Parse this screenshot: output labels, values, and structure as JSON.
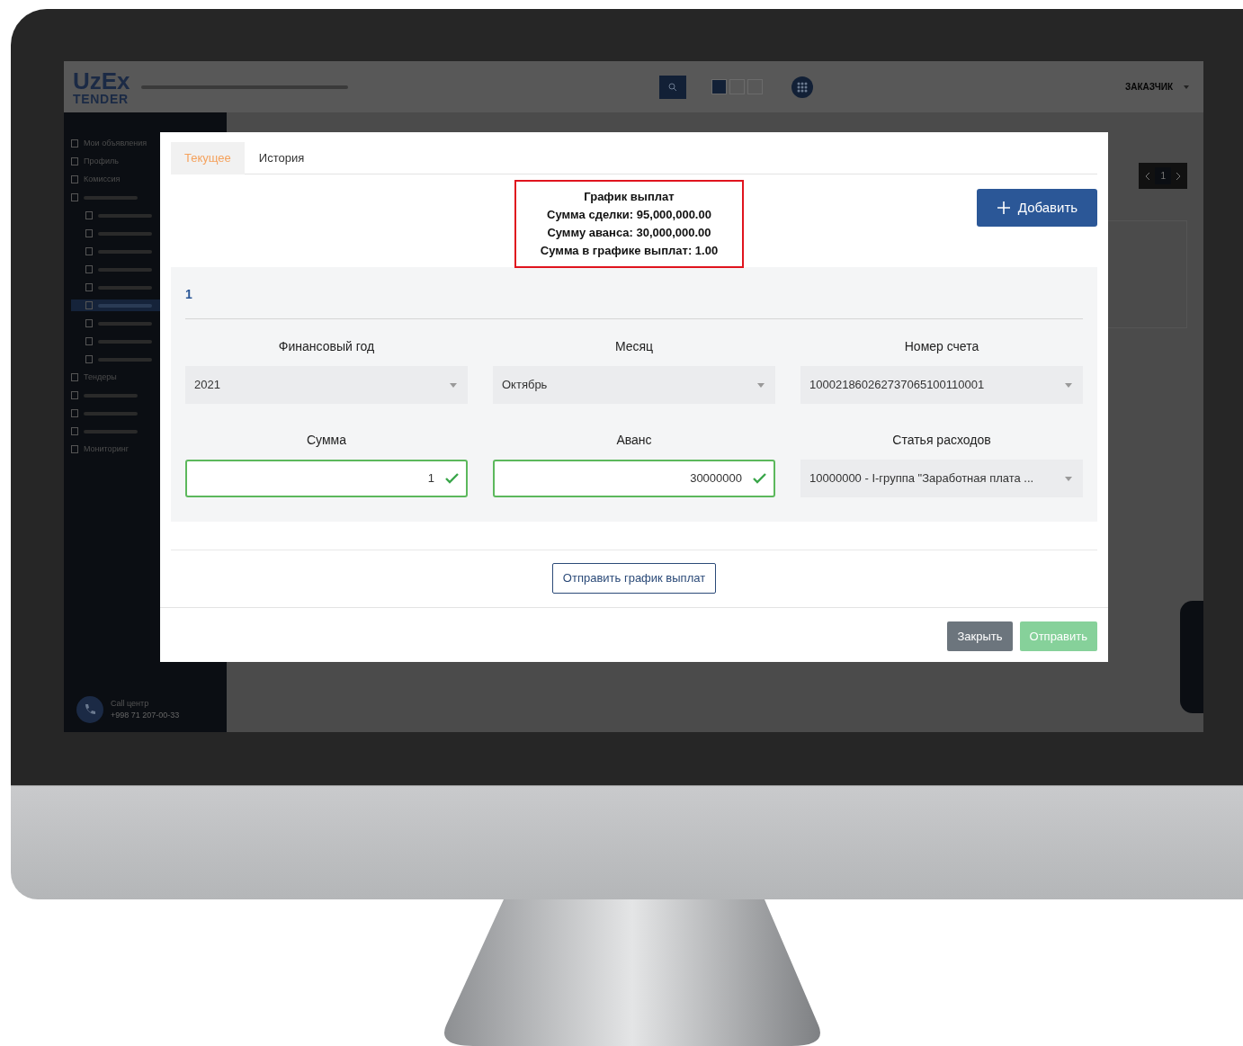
{
  "app": {
    "logo": {
      "top": "UzEx",
      "bottom": "TENDER"
    },
    "header": {
      "user": "ЗАКАЗЧИК"
    },
    "sidebar": {
      "items": [
        {
          "label": "Мои объявления",
          "selected": false
        },
        {
          "label": "Профиль",
          "selected": false
        },
        {
          "label": "Комиссия",
          "selected": false
        },
        {
          "selected": false,
          "children": [
            {
              "selected": false
            },
            {
              "selected": false
            },
            {
              "selected": false
            },
            {
              "selected": false
            },
            {
              "selected": false
            },
            {
              "selected": true
            },
            {
              "selected": false
            },
            {
              "selected": false
            },
            {
              "selected": false
            }
          ]
        },
        {
          "label": "Тендеры",
          "selected": false
        },
        {
          "selected": false
        },
        {
          "selected": false
        },
        {
          "selected": false
        },
        {
          "label": "Мониторинг",
          "selected": false
        }
      ]
    },
    "call_center": {
      "label": "Call центр",
      "phone": "+998 71 207-00-33"
    },
    "pager": {
      "page": "1"
    }
  },
  "modal": {
    "tabs": [
      {
        "label": "Текущее",
        "selected": true
      },
      {
        "label": "История",
        "selected": false
      }
    ],
    "summary": {
      "title": "График выплат",
      "lines": [
        "Сумма сделки: 95,000,000.00",
        "Сумму аванса: 30,000,000.00",
        "Сумма в графике выплат: 1.00"
      ]
    },
    "add_button": "Добавить",
    "section": {
      "number": "1",
      "fields": [
        {
          "kind": "select",
          "label": "Финансовый год",
          "value": "2021"
        },
        {
          "kind": "select",
          "label": "Месяц",
          "value": "Октябрь"
        },
        {
          "kind": "select",
          "label": "Номер счета",
          "value": "100021860262737065100110001"
        },
        {
          "kind": "input",
          "label": "Сумма",
          "value": "1",
          "valid": true
        },
        {
          "kind": "input",
          "label": "Аванс",
          "value": "30000000",
          "valid": true
        },
        {
          "kind": "select",
          "label": "Статья расходов",
          "value": "10000000 - I-группа \"Заработная плата ..."
        }
      ]
    },
    "send_schedule_button": "Отправить график выплат",
    "close_button": "Закрыть",
    "submit_button": {
      "label": "Отправить",
      "disabled": true
    }
  }
}
